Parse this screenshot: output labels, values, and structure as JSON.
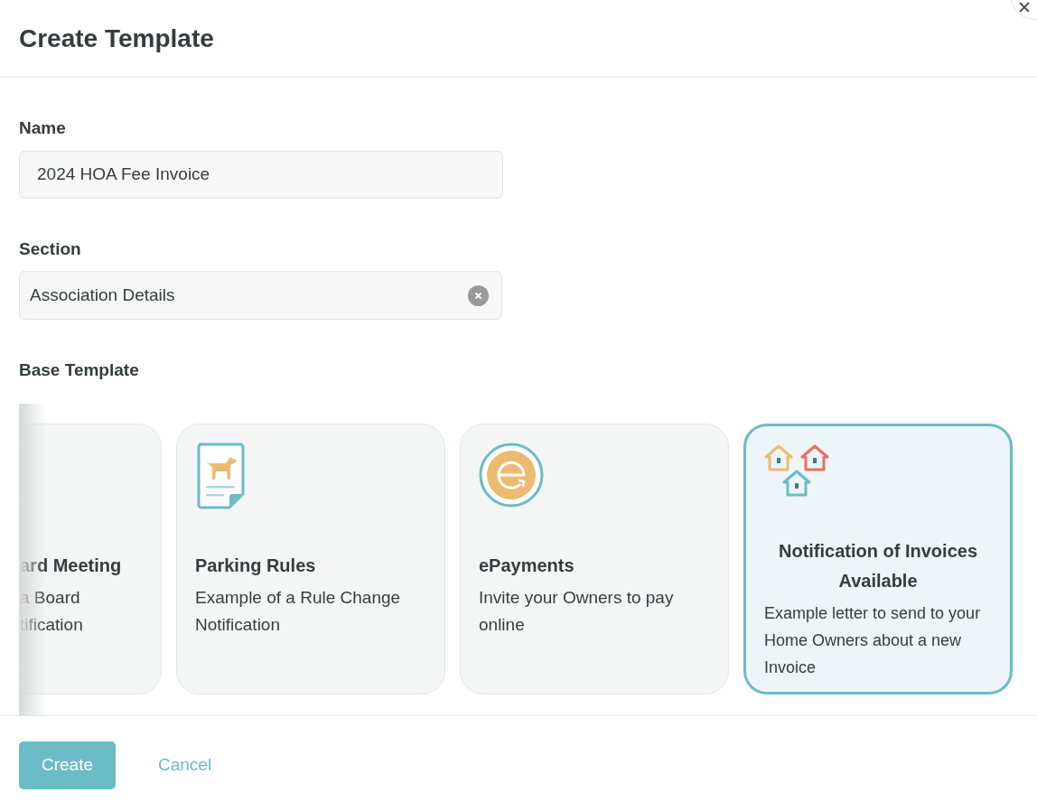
{
  "dialog": {
    "title": "Create Template"
  },
  "name_field": {
    "label": "Name",
    "value": "2024 HOA Fee Invoice"
  },
  "section_field": {
    "label": "Section",
    "value": "Association Details"
  },
  "base_template": {
    "label": "Base Template",
    "cards": [
      {
        "title": "ard Meeting",
        "description_lines": [
          "a Board",
          "tification"
        ],
        "selected": false
      },
      {
        "title": "Parking Rules",
        "description_lines": [
          "Example of a Rule Change Notification"
        ],
        "selected": false
      },
      {
        "title": "ePayments",
        "description_lines": [
          "Invite your Owners to pay online"
        ],
        "selected": false
      },
      {
        "title": "Notification of Invoices Available",
        "description_lines": [
          "Example letter to send to your Home Owners about a new Invoice"
        ],
        "selected": true
      }
    ]
  },
  "buttons": {
    "create": "Create",
    "cancel": "Cancel"
  }
}
